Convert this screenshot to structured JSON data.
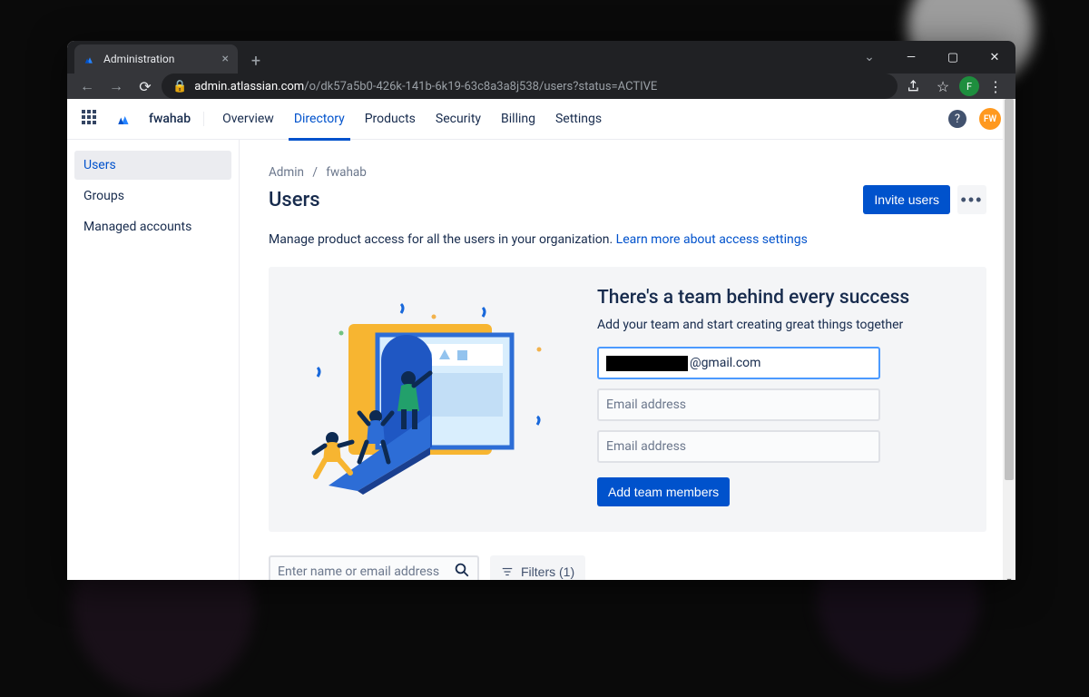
{
  "browser": {
    "tab_title": "Administration",
    "url_domain": "admin.atlassian.com",
    "url_path": "/o/dk57a5b0-426k-141b-6k19-63c8a3a8j538/users?status=ACTIVE",
    "profile_initial": "F"
  },
  "topnav": {
    "org": "fwahab",
    "links": [
      "Overview",
      "Directory",
      "Products",
      "Security",
      "Billing",
      "Settings"
    ],
    "active_index": 1,
    "user_initials": "FW"
  },
  "sidebar": {
    "items": [
      "Users",
      "Groups",
      "Managed accounts"
    ],
    "selected_index": 0
  },
  "breadcrumb": {
    "root": "Admin",
    "leaf": "fwahab"
  },
  "page": {
    "title": "Users",
    "invite_label": "Invite users",
    "desc_text": "Manage product access for all the users in your organization. ",
    "desc_link": "Learn more about access settings"
  },
  "hero": {
    "heading": "There's a team behind every success",
    "subheading": "Add your team and start creating great things together",
    "email1_visible_tail": "@gmail.com",
    "email_placeholder": "Email address",
    "add_label": "Add team members"
  },
  "filters": {
    "search_placeholder": "Enter name or email address",
    "button_label": "Filters (1)"
  }
}
